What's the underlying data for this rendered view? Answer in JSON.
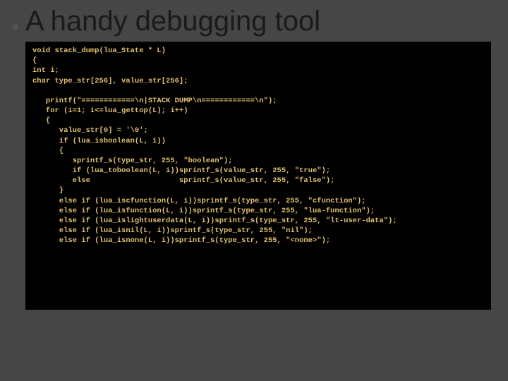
{
  "slide": {
    "title": "A handy debugging tool",
    "code": "void stack_dump(lua_State * L)\n{\nint i;\nchar type_str[256], value_str[256];\n\n   printf(\"============\\n|STACK DUMP\\n============\\n\");\n   for (i=1; i<=lua_gettop(L); i++)\n   {\n      value_str[0] = '\\0';\n      if (lua_isboolean(L, i))\n      {\n         sprintf_s(type_str, 255, \"boolean\");\n         if (lua_toboolean(L, i))sprintf_s(value_str, 255, \"true\");\n         else                    sprintf_s(value_str, 255, \"false\");\n      }\n      else if (lua_iscfunction(L, i))sprintf_s(type_str, 255, \"cfunction\");\n      else if (lua_isfunction(L, i))sprintf_s(type_str, 255, \"lua-function\");\n      else if (lua_islightuserdata(L, i))sprintf_s(type_str, 255, \"lt-user-data\");\n      else if (lua_isnil(L, i))sprintf_s(type_str, 255, \"nil\");\n      else if (lua_isnone(L, i))sprintf_s(type_str, 255, \"<none>\");"
  }
}
